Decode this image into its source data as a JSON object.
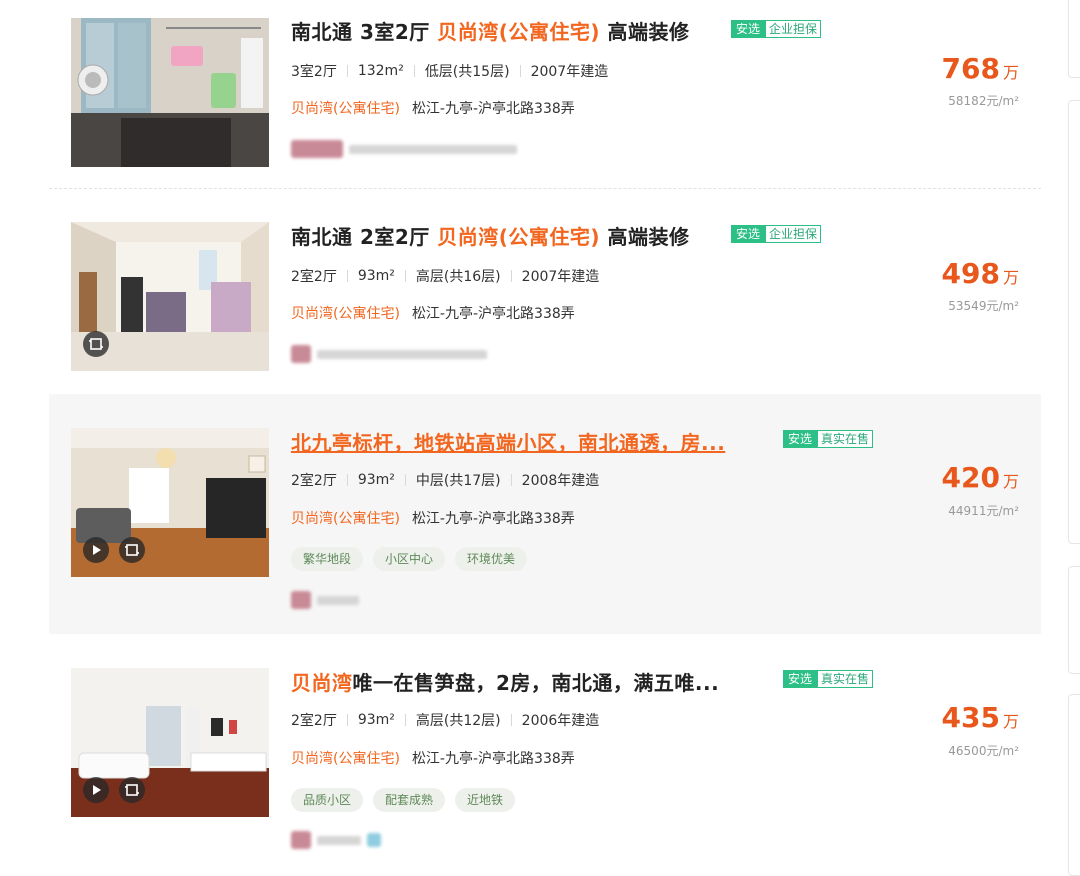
{
  "listings": [
    {
      "title_prefix": "南北通 3室2厅 ",
      "title_highlight": "贝尚湾(公寓住宅)",
      "title_suffix": " 高端装修",
      "tag_primary": "安选",
      "tag_secondary": "企业担保",
      "rooms": "3室2厅",
      "area": "132m²",
      "floor": "低层(共15层)",
      "built": "2007年建造",
      "community": "贝尚湾(公寓住宅)",
      "address": "松江-九亭-沪亭北路338弄",
      "chips": [],
      "price": "768",
      "price_unit": "万",
      "unit_price": "58182元/m²",
      "photo_icons": []
    },
    {
      "title_prefix": "南北通 2室2厅 ",
      "title_highlight": "贝尚湾(公寓住宅)",
      "title_suffix": " 高端装修",
      "tag_primary": "安选",
      "tag_secondary": "企业担保",
      "rooms": "2室2厅",
      "area": "93m²",
      "floor": "高层(共16层)",
      "built": "2007年建造",
      "community": "贝尚湾(公寓住宅)",
      "address": "松江-九亭-沪亭北路338弄",
      "chips": [],
      "price": "498",
      "price_unit": "万",
      "unit_price": "53549元/m²",
      "photo_icons": [
        "vr-icon"
      ]
    },
    {
      "title_full": "北九亭标杆，地铁站高端小区，南北通透，房...",
      "tag_primary": "安选",
      "tag_secondary": "真实在售",
      "rooms": "2室2厅",
      "area": "93m²",
      "floor": "中层(共17层)",
      "built": "2008年建造",
      "community": "贝尚湾(公寓住宅)",
      "address": "松江-九亭-沪亭北路338弄",
      "chips": [
        "繁华地段",
        "小区中心",
        "环境优美"
      ],
      "price": "420",
      "price_unit": "万",
      "unit_price": "44911元/m²",
      "photo_icons": [
        "video-play-icon",
        "vr-icon"
      ]
    },
    {
      "title_highlight": "贝尚湾",
      "title_suffix": "唯一在售笋盘，2房，南北通，满五唯...",
      "tag_primary": "安选",
      "tag_secondary": "真实在售",
      "rooms": "2室2厅",
      "area": "93m²",
      "floor": "高层(共12层)",
      "built": "2006年建造",
      "community": "贝尚湾(公寓住宅)",
      "address": "松江-九亭-沪亭北路338弄",
      "chips": [
        "品质小区",
        "配套成熟",
        "近地铁"
      ],
      "price": "435",
      "price_unit": "万",
      "unit_price": "46500元/m²",
      "photo_icons": [
        "video-play-icon",
        "vr-icon"
      ]
    }
  ],
  "colors": {
    "accent": "#f2661f",
    "price": "#e8571b",
    "tag_green": "#2cbf86",
    "chip_bg": "#eef0ec",
    "chip_text": "#5e8a58",
    "highlight_row": "#f6f6f6"
  }
}
